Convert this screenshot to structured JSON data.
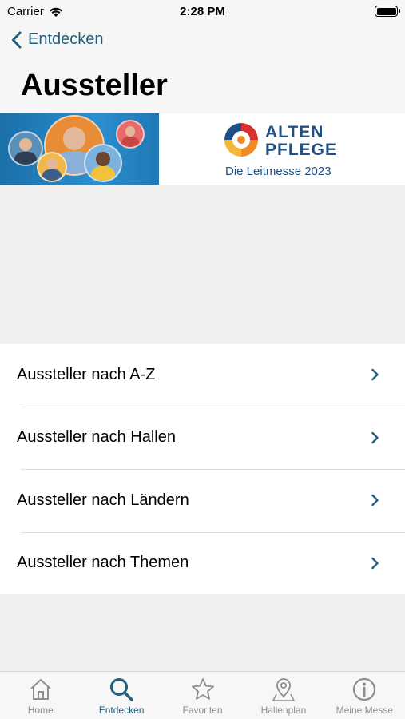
{
  "status_bar": {
    "carrier": "Carrier",
    "time": "2:28 PM",
    "icons": [
      "wifi-icon",
      "battery-icon"
    ]
  },
  "nav": {
    "back_label": "Entdecken",
    "title": "Aussteller"
  },
  "banner": {
    "logo_line1": "ALTEN",
    "logo_line2": "PFLEGE",
    "tagline": "Die Leitmesse 2023"
  },
  "menu": {
    "items": [
      {
        "label": "Aussteller nach A-Z"
      },
      {
        "label": "Aussteller nach Hallen"
      },
      {
        "label": "Aussteller nach Ländern"
      },
      {
        "label": "Aussteller nach Themen"
      }
    ]
  },
  "tab_bar": {
    "tabs": [
      {
        "label": "Home",
        "icon": "home-icon"
      },
      {
        "label": "Entdecken",
        "icon": "search-icon",
        "active": true
      },
      {
        "label": "Favoriten",
        "icon": "star-icon"
      },
      {
        "label": "Hallenplan",
        "icon": "map-pin-icon"
      },
      {
        "label": "Meine Messe",
        "icon": "info-icon"
      }
    ]
  },
  "colors": {
    "accent": "#1f5f7f",
    "inactive": "#8e8e93",
    "logo_blue": "#1f4f84",
    "logo_orange": "#f08a24",
    "logo_red": "#d6332c"
  }
}
